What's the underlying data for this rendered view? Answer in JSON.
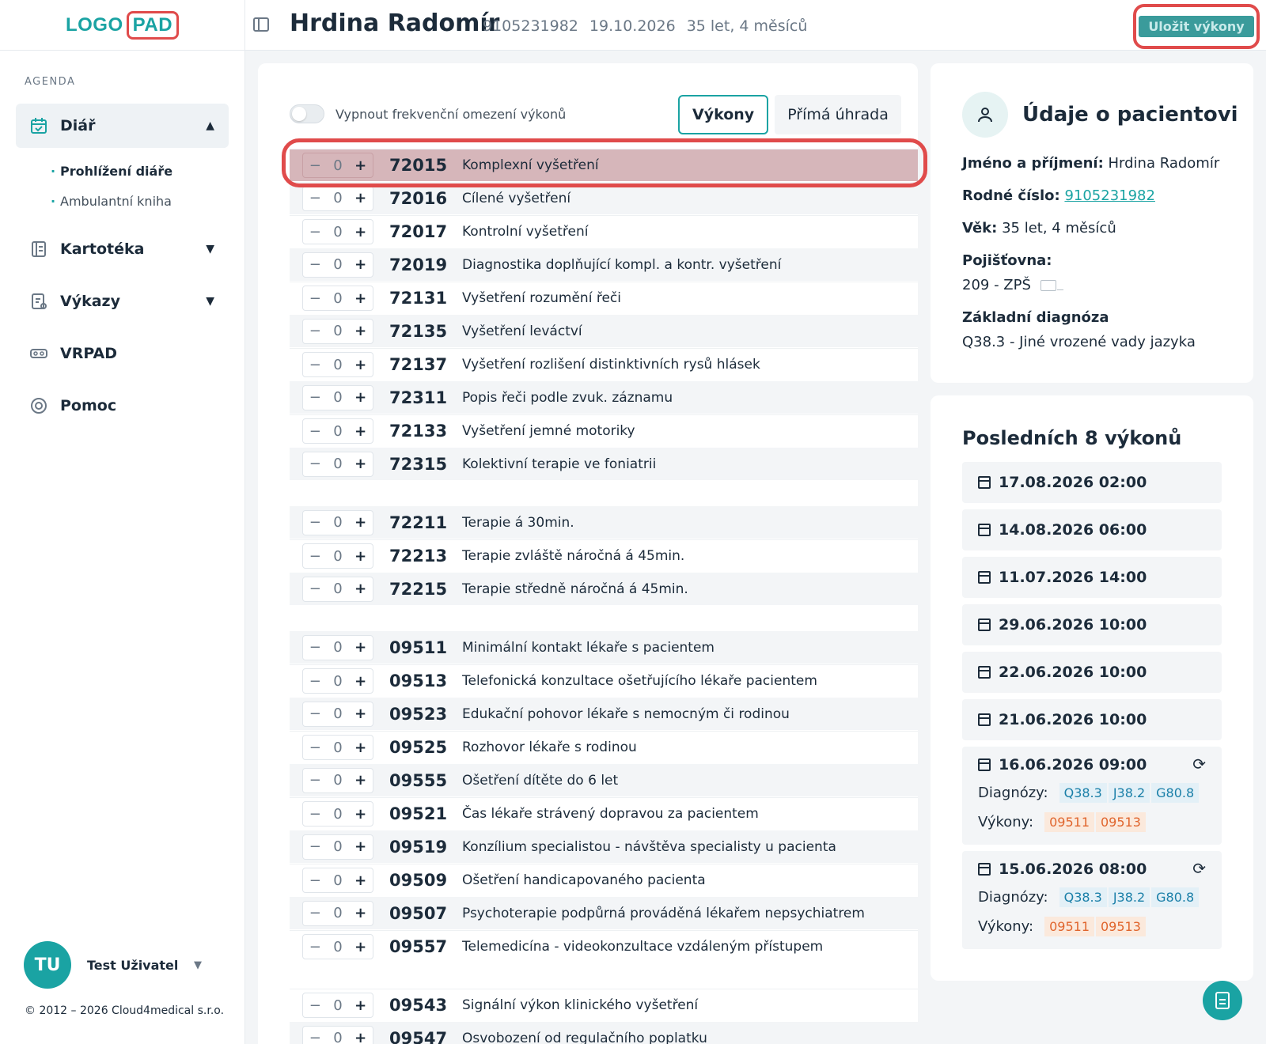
{
  "brand": {
    "logo_part1": "LOGO",
    "logo_part2": "PAD"
  },
  "sidebar": {
    "section_label": "AGENDA",
    "items": [
      {
        "label": "Diář",
        "icon": "calendar-icon",
        "active": true
      },
      {
        "label": "Kartotéka",
        "icon": "file-cabinet-icon"
      },
      {
        "label": "Výkazy",
        "icon": "report-icon"
      },
      {
        "label": "VRPAD",
        "icon": "vr-headset-icon"
      },
      {
        "label": "Pomoc",
        "icon": "lifebuoy-icon"
      }
    ],
    "subitems": [
      {
        "label": "Prohlížení diáře",
        "active": true
      },
      {
        "label": "Ambulantní kniha"
      }
    ],
    "user": {
      "initials": "TU",
      "name": "Test Uživatel"
    },
    "copyright": "© 2012 – 2026 Cloud4medical s.r.o."
  },
  "header": {
    "patient_name": "Hrdina Radomír",
    "rc": "9105231982",
    "date": "19.10.2026",
    "age": "35 let, 4 měsíců",
    "save_label": "Uložit výkony"
  },
  "procedures": {
    "toggle_label": "Vypnout frekvenční omezení výkonů",
    "tabs": [
      "Výkony",
      "Přímá úhrada"
    ],
    "rows": [
      {
        "qty": "0",
        "code": "72015",
        "desc": "Komplexní vyšetření"
      },
      {
        "qty": "0",
        "code": "72016",
        "desc": "Cílené vyšetření"
      },
      {
        "qty": "0",
        "code": "72017",
        "desc": "Kontrolní vyšetření"
      },
      {
        "qty": "0",
        "code": "72019",
        "desc": "Diagnostika doplňující kompl. a kontr. vyšetření"
      },
      {
        "qty": "0",
        "code": "72131",
        "desc": "Vyšetření rozumění řeči"
      },
      {
        "qty": "0",
        "code": "72135",
        "desc": "Vyšetření leváctví"
      },
      {
        "qty": "0",
        "code": "72137",
        "desc": "Vyšetření rozlišení distinktivních rysů hlásek"
      },
      {
        "qty": "0",
        "code": "72311",
        "desc": "Popis řeči podle zvuk. záznamu"
      },
      {
        "qty": "0",
        "code": "72133",
        "desc": "Vyšetření jemné motoriky"
      },
      {
        "qty": "0",
        "code": "72315",
        "desc": "Kolektivní terapie ve foniatrii"
      },
      {
        "qty": "0",
        "code": "72211",
        "desc": "Terapie á 30min."
      },
      {
        "qty": "0",
        "code": "72213",
        "desc": "Terapie zvláště náročná á 45min."
      },
      {
        "qty": "0",
        "code": "72215",
        "desc": "Terapie středně náročná á 45min."
      },
      {
        "qty": "0",
        "code": "09511",
        "desc": "Minimální kontakt lékaře s pacientem"
      },
      {
        "qty": "0",
        "code": "09513",
        "desc": "Telefonická konzultace ošetřujícího lékaře pacientem"
      },
      {
        "qty": "0",
        "code": "09523",
        "desc": "Edukační pohovor lékaře s nemocným či rodinou"
      },
      {
        "qty": "0",
        "code": "09525",
        "desc": "Rozhovor lékaře s rodinou"
      },
      {
        "qty": "0",
        "code": "09555",
        "desc": "Ošetření dítěte do 6 let"
      },
      {
        "qty": "0",
        "code": "09521",
        "desc": "Čas lékaře strávený dopravou za pacientem"
      },
      {
        "qty": "0",
        "code": "09519",
        "desc": "Konzílium specialistou - návštěva specialisty u pacienta"
      },
      {
        "qty": "0",
        "code": "09509",
        "desc": "Ošetření handicapovaného pacienta"
      },
      {
        "qty": "0",
        "code": "09507",
        "desc": "Psychoterapie podpůrná prováděná lékařem nepsychiatrem"
      },
      {
        "qty": "0",
        "code": "09557",
        "desc": "Telemedicína - videokonzultace vzdáleným přístupem"
      },
      {
        "qty": "0",
        "code": "09543",
        "desc": "Signální výkon klinického vyšetření"
      },
      {
        "qty": "0",
        "code": "09547",
        "desc": "Osvobození od regulačního poplatku"
      }
    ]
  },
  "patient_info": {
    "title": "Údaje o pacientovi",
    "name_label": "Jméno a příjmení:",
    "name_value": "Hrdina Radomír",
    "rc_label": "Rodné číslo:",
    "rc_value": "9105231982",
    "age_label": "Věk:",
    "age_value": "35 let, 4 měsíců",
    "insurance_label": "Pojišťovna:",
    "insurance_value": "209 - ZPŠ",
    "diagnosis_label": "Základní diagnóza",
    "diagnosis_value": "Q38.3 - Jiné vrozené vady jazyka"
  },
  "last_visits": {
    "title": "Posledních 8 výkonů",
    "diag_label": "Diagnózy:",
    "proc_label": "Výkony:",
    "items": [
      {
        "date": "17.08.2026 02:00"
      },
      {
        "date": "14.08.2026 06:00"
      },
      {
        "date": "11.07.2026 14:00"
      },
      {
        "date": "29.06.2026 10:00"
      },
      {
        "date": "22.06.2026 10:00"
      },
      {
        "date": "21.06.2026 10:00"
      },
      {
        "date": "16.06.2026 09:00",
        "diagnoses": [
          "Q38.3",
          "J38.2",
          "G80.8"
        ],
        "procedures": [
          "09511",
          "09513"
        ]
      },
      {
        "date": "15.06.2026 08:00",
        "diagnoses": [
          "Q38.3",
          "J38.2",
          "G80.8"
        ],
        "procedures": [
          "09511",
          "09513"
        ]
      }
    ]
  },
  "colors": {
    "accent": "#1aa3a3",
    "highlight": "#e04b4b"
  }
}
